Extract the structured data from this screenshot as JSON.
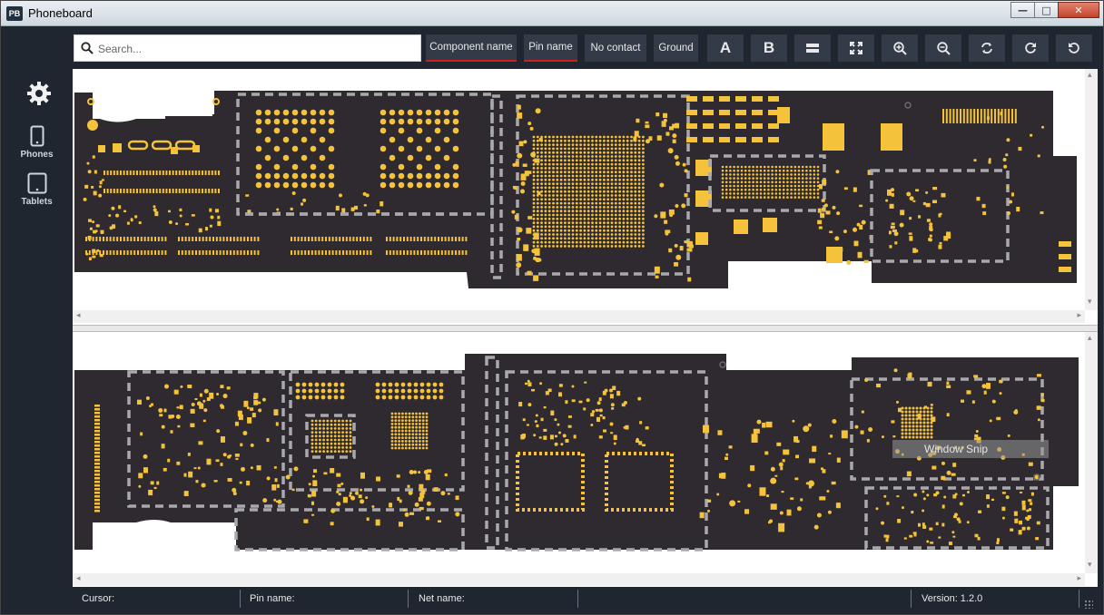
{
  "app": {
    "icon_text": "PB",
    "title": "Phoneboard"
  },
  "window_controls": {
    "minimize": "—",
    "maximize": "□",
    "close": "✕"
  },
  "sidebar": {
    "items": [
      {
        "label": "",
        "icon": "gear-icon"
      },
      {
        "label": "Phones",
        "icon": "phone-icon"
      },
      {
        "label": "Tablets",
        "icon": "tablet-icon"
      }
    ]
  },
  "toolbar": {
    "search_placeholder": "Search...",
    "buttons": [
      {
        "label": "Component name",
        "active": true
      },
      {
        "label": "Pin name",
        "active": true
      },
      {
        "label": "No contact",
        "active": false
      },
      {
        "label": "Ground",
        "active": false
      },
      {
        "label": "A",
        "icon": "side-a-icon"
      },
      {
        "label": "B",
        "icon": "side-b-icon"
      },
      {
        "label": "",
        "icon": "split-view-icon"
      },
      {
        "label": "",
        "icon": "fit-screen-icon"
      },
      {
        "label": "",
        "icon": "zoom-in-icon"
      },
      {
        "label": "",
        "icon": "zoom-out-icon"
      },
      {
        "label": "",
        "icon": "flip-icon"
      },
      {
        "label": "",
        "icon": "rotate-cw-icon"
      },
      {
        "label": "",
        "icon": "rotate-ccw-icon"
      }
    ]
  },
  "status": {
    "cursor_label": "Cursor:",
    "pin_label": "Pin name:",
    "net_label": "Net name:",
    "version_label": "Version: 1.2.0"
  },
  "overlay": {
    "snip_text": "Window Snip"
  },
  "colors": {
    "board": "#2e2a2f",
    "pad": "#f5c33b",
    "silk": "#a9a9ad",
    "chrome": "#1f2630",
    "button": "#323b47",
    "active_underline": "#d21e1e"
  }
}
